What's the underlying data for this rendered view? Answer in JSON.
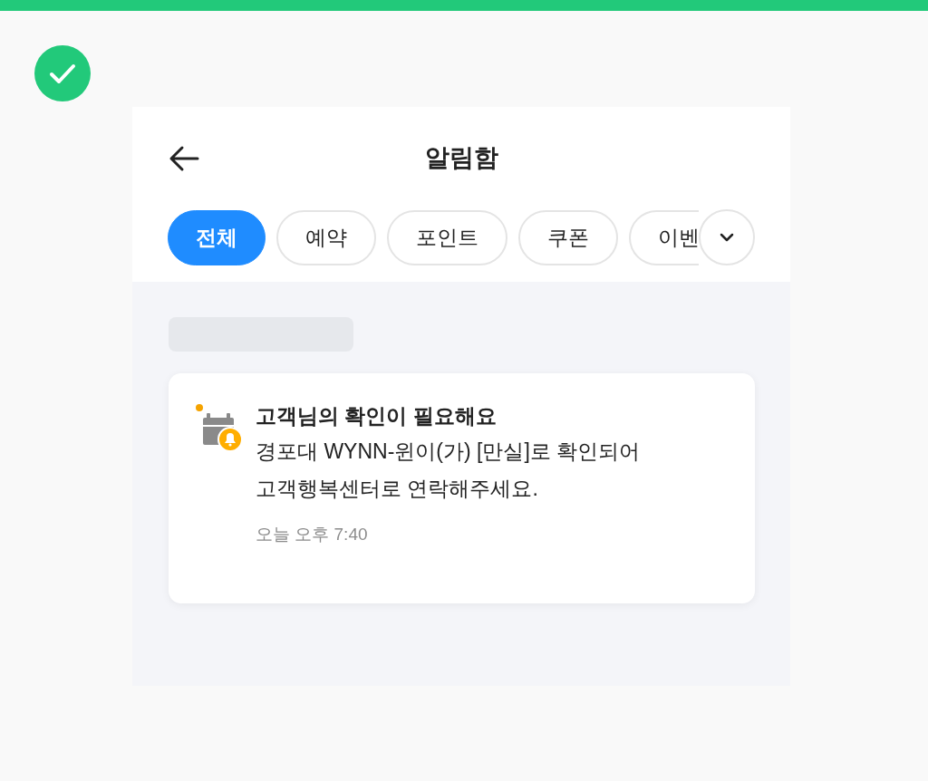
{
  "page": {
    "success": true
  },
  "header": {
    "title": "알림함"
  },
  "tabs": [
    {
      "label": "전체",
      "selected": true
    },
    {
      "label": "예약",
      "selected": false
    },
    {
      "label": "포인트",
      "selected": false
    },
    {
      "label": "쿠폰",
      "selected": false
    },
    {
      "label": "이벤",
      "selected": false
    }
  ],
  "notifications": [
    {
      "unread": true,
      "title": "고객님의 확인이 필요해요",
      "body": "경포대 WYNN-윈이(가) [만실]로 확인되어\n고객행복센터로 연락해주세요.",
      "time": "오늘 오후 7:40"
    }
  ]
}
